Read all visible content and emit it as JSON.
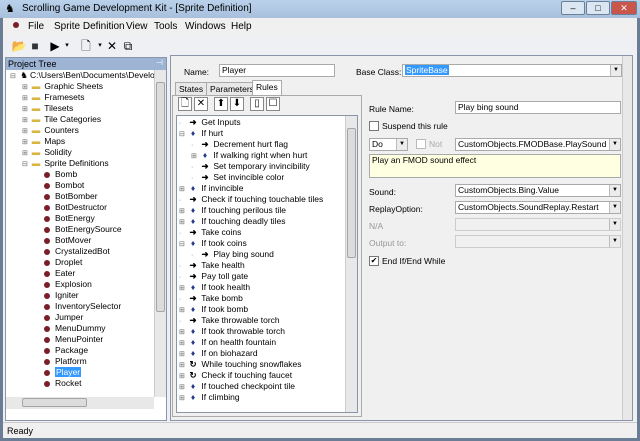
{
  "window": {
    "title": "Scrolling Game Development Kit - [Sprite Definition]"
  },
  "menu": [
    "File",
    "Sprite Definition",
    "View",
    "Tools",
    "Windows",
    "Help"
  ],
  "project_tree": {
    "header": "Project Tree",
    "root": "C:\\Users\\Ben\\Documents\\Develo",
    "folders": [
      "Graphic Sheets",
      "Framesets",
      "Tilesets",
      "Tile Categories",
      "Counters",
      "Maps",
      "Solidity",
      "Sprite Definitions"
    ],
    "sprites": [
      "Bomb",
      "Bombot",
      "BotBomber",
      "BotDestructor",
      "BotEnergy",
      "BotEnergySource",
      "BotMover",
      "CrystalizedBot",
      "Droplet",
      "Eater",
      "Explosion",
      "Igniter",
      "InventorySelector",
      "Jumper",
      "MenuDummy",
      "MenuPointer",
      "Package",
      "Platform",
      "Player",
      "Rocket"
    ],
    "selected": "Player"
  },
  "sprite": {
    "name_label": "Name:",
    "name": "Player",
    "base_class_label": "Base Class:",
    "base_class": "SpriteBase"
  },
  "tabs": [
    "States",
    "Parameters",
    "Rules"
  ],
  "active_tab": "Rules",
  "rules": [
    {
      "l": 0,
      "t": "action",
      "x": "",
      "text": "Get Inputs"
    },
    {
      "l": 0,
      "t": "if",
      "x": "-",
      "text": "If hurt"
    },
    {
      "l": 1,
      "t": "action",
      "x": "",
      "text": "Decrement hurt flag"
    },
    {
      "l": 1,
      "t": "if",
      "x": "+",
      "text": "If walking right when hurt"
    },
    {
      "l": 1,
      "t": "action",
      "x": "",
      "text": "Set temporary invincibility"
    },
    {
      "l": 1,
      "t": "action",
      "x": "",
      "text": "Set invincible color"
    },
    {
      "l": 0,
      "t": "if",
      "x": "+",
      "text": "If invincible"
    },
    {
      "l": 0,
      "t": "action",
      "x": "",
      "text": "Check if touching touchable tiles"
    },
    {
      "l": 0,
      "t": "if",
      "x": "+",
      "text": "If touching perilous tile"
    },
    {
      "l": 0,
      "t": "if",
      "x": "+",
      "text": "If touching deadly tiles"
    },
    {
      "l": 0,
      "t": "action",
      "x": "",
      "text": "Take coins"
    },
    {
      "l": 0,
      "t": "if",
      "x": "-",
      "text": "If took coins"
    },
    {
      "l": 1,
      "t": "action",
      "x": "",
      "text": "Play bing sound"
    },
    {
      "l": 0,
      "t": "action",
      "x": "",
      "text": "Take health"
    },
    {
      "l": 0,
      "t": "action",
      "x": "",
      "text": "Pay toll gate"
    },
    {
      "l": 0,
      "t": "if",
      "x": "+",
      "text": "If took health"
    },
    {
      "l": 0,
      "t": "action",
      "x": "",
      "text": "Take bomb"
    },
    {
      "l": 0,
      "t": "if",
      "x": "+",
      "text": "If took bomb"
    },
    {
      "l": 0,
      "t": "action",
      "x": "",
      "text": "Take throwable torch"
    },
    {
      "l": 0,
      "t": "if",
      "x": "+",
      "text": "If took throwable torch"
    },
    {
      "l": 0,
      "t": "if",
      "x": "+",
      "text": "If on health fountain"
    },
    {
      "l": 0,
      "t": "if",
      "x": "+",
      "text": "If on biohazard"
    },
    {
      "l": 0,
      "t": "while",
      "x": "+",
      "text": "While touching snowflakes"
    },
    {
      "l": 0,
      "t": "while",
      "x": "+",
      "text": "Check if touching faucet"
    },
    {
      "l": 0,
      "t": "if",
      "x": "+",
      "text": "If touched checkpoint tile"
    },
    {
      "l": 0,
      "t": "if",
      "x": "+",
      "text": "If climbing"
    }
  ],
  "rule": {
    "name_label": "Rule Name:",
    "name": "Play bing sound",
    "suspend_label": "Suspend this rule",
    "suspended": false,
    "type": "Do",
    "not_label": "Not",
    "function": "CustomObjects.FMODBase.PlaySound",
    "description": "Play an FMOD sound effect",
    "params": [
      {
        "label": "Sound:",
        "value": "CustomObjects.Bing.Value",
        "enabled": true
      },
      {
        "label": "ReplayOption:",
        "value": "CustomObjects.SoundReplay.Restart",
        "enabled": true
      },
      {
        "label": "N/A",
        "value": "",
        "enabled": false
      },
      {
        "label": "Output to:",
        "value": "",
        "enabled": false
      }
    ],
    "end_label": "End If/End While",
    "end_checked": true
  },
  "status": "Ready"
}
